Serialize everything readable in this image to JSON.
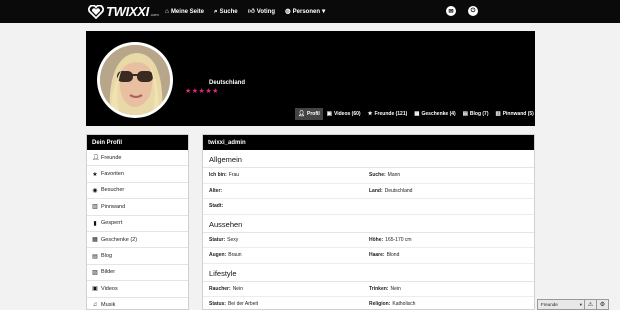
{
  "brand": {
    "name": "TWIXXI",
    "tld": ".com"
  },
  "nav": {
    "items": [
      {
        "label": "Meine Seite",
        "icon": "home-icon"
      },
      {
        "label": "Suche",
        "icon": "search-icon"
      },
      {
        "label": "Voting",
        "icon": "thumbs-up-icon"
      },
      {
        "label": "Personen",
        "icon": "globe-icon"
      }
    ],
    "mail_icon": "mail-icon",
    "power_icon": "power-icon"
  },
  "profile": {
    "country": "Deutschland",
    "rating": 5,
    "tabs": [
      {
        "label": "Profil",
        "icon": "user-icon",
        "active": true
      },
      {
        "label": "Videos (60)",
        "icon": "video-icon"
      },
      {
        "label": "Freunde (121)",
        "icon": "star-icon"
      },
      {
        "label": "Geschenke (4)",
        "icon": "gift-icon"
      },
      {
        "label": "Blog (7)",
        "icon": "book-icon"
      },
      {
        "label": "Pinnwand (5)",
        "icon": "board-icon"
      }
    ]
  },
  "sidebar": {
    "title": "Dein Profil",
    "items": [
      {
        "label": "Freunde",
        "icon": "user-icon"
      },
      {
        "label": "Favoriten",
        "icon": "star-icon"
      },
      {
        "label": "Besucher",
        "icon": "eye-icon"
      },
      {
        "label": "Pinnwand",
        "icon": "board-icon"
      },
      {
        "label": "Gesperrt",
        "icon": "block-icon"
      },
      {
        "label": "Geschenke (2)",
        "icon": "gift-icon"
      },
      {
        "label": "Blog",
        "icon": "book-icon"
      },
      {
        "label": "Bilder",
        "icon": "image-icon"
      },
      {
        "label": "Videos",
        "icon": "video-icon"
      },
      {
        "label": "Musik",
        "icon": "music-icon"
      }
    ]
  },
  "main": {
    "username": "twixxi_admin",
    "sections": [
      {
        "title": "Allgemein",
        "rows": [
          [
            {
              "key": "Ich bin:",
              "value": "Frau"
            },
            {
              "key": "Suche:",
              "value": "Mann"
            }
          ],
          [
            {
              "key": "Alter:",
              "value": ""
            },
            {
              "key": "Land:",
              "value": "Deutschland"
            }
          ],
          [
            {
              "key": "Stadt:",
              "value": ""
            },
            null
          ]
        ]
      },
      {
        "title": "Aussehen",
        "rows": [
          [
            {
              "key": "Statur:",
              "value": "Sexy"
            },
            {
              "key": "Höhe:",
              "value": "165-170 cm"
            }
          ],
          [
            {
              "key": "Augen:",
              "value": "Braun"
            },
            {
              "key": "Haare:",
              "value": "Blond"
            }
          ]
        ]
      },
      {
        "title": "Lifestyle",
        "rows": [
          [
            {
              "key": "Raucher:",
              "value": "Nein"
            },
            {
              "key": "Trinken:",
              "value": "Nein"
            }
          ],
          [
            {
              "key": "Status:",
              "value": "Bei der Arbeit"
            },
            {
              "key": "Religion:",
              "value": "Katholisch"
            }
          ]
        ]
      }
    ]
  },
  "chat": {
    "select_value": "Freunde",
    "warn_icon": "warning-icon",
    "settings_icon": "gear-icon"
  },
  "colors": {
    "accent_pink": "#e2287e",
    "header_bg": "#0a0a0a"
  }
}
